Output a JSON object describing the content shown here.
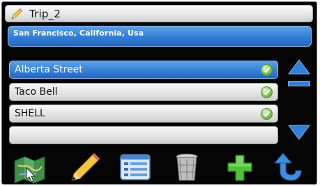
{
  "header": {
    "title": "Trip_2",
    "title_icon": "pencil-icon"
  },
  "address": {
    "text": "San Francisco, California, Usa"
  },
  "stops": [
    {
      "label": "Alberta Street",
      "selected": true,
      "status_icon": "check-circle-icon"
    },
    {
      "label": "Taco Bell",
      "selected": false,
      "status_icon": "check-circle-icon"
    },
    {
      "label": "SHELL",
      "selected": false,
      "status_icon": "check-circle-icon"
    },
    {
      "label": "",
      "selected": false,
      "status_icon": ""
    }
  ],
  "scroll": {
    "up_icon": "triangle-up-icon",
    "down_icon": "triangle-down-icon",
    "position_icon": "scroll-position-icon"
  },
  "toolbar": {
    "items": [
      {
        "name": "map-icon"
      },
      {
        "name": "pencil-icon"
      },
      {
        "name": "list-icon"
      },
      {
        "name": "trash-icon"
      },
      {
        "name": "plus-icon"
      },
      {
        "name": "back-arrow-icon"
      }
    ]
  },
  "colors": {
    "accent": "#317dd4",
    "background": "#050505",
    "check": "#7ec454",
    "row": "#e4e4e4"
  }
}
